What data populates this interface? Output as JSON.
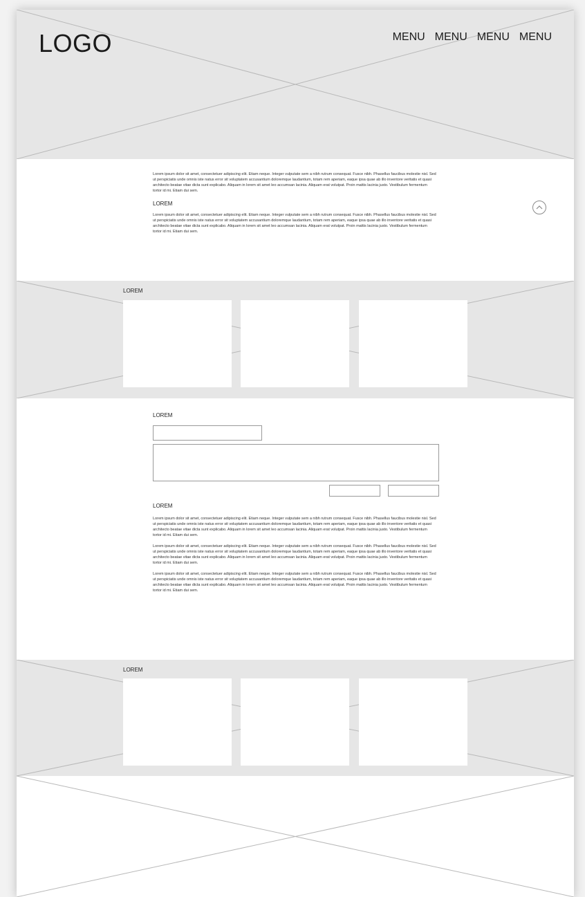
{
  "header": {
    "logo": "LOGO",
    "menu": [
      "MENU",
      "MENU",
      "MENU",
      "MENU"
    ]
  },
  "intro": {
    "paragraph_1": "Lorem ipsum dolor sit amet, consectetuer adipiscing elit. Etiam neque. Integer vulputate sem a nibh rutrum consequat. Fusce nibh. Phasellus faucibus molestie nisl. Sed ut perspiciatis unde omnis iste natus error sit voluptatem accusantium doloremque laudantium, totam rem aperiam, eaque ipsa quae ab illo inventore veritatis et quasi architecto beatae vitae dicta sunt explicabo. Aliquam in lorem sit amet leo accumsan lacinia. Aliquam erat volutpat. Proin mattis lacinia justo. Vestibulum fermentum tortor id mi. Etiam dui sem.",
    "heading": "LOREM",
    "paragraph_2": "Lorem ipsum dolor sit amet, consectetuer adipiscing elit. Etiam neque. Integer vulputate sem a nibh rutrum consequat. Fusce nibh. Phasellus faucibus molestie nisl. Sed ut perspiciatis unde omnis iste natus error sit voluptatem accusantium doloremque laudantium, totam rem aperiam, eaque ipsa quae ab illo inventore veritatis et quasi architecto beatae vitae dicta sunt explicabo. Aliquam in lorem sit amet leo accumsan lacinia. Aliquam erat volutpat. Proin mattis lacinia justo. Vestibulum fermentum tortor id mi. Etiam dui sem."
  },
  "gallery_1": {
    "label": "LOREM"
  },
  "form": {
    "heading": "LOREM",
    "text_heading": "LOREM",
    "paragraph_1": "Lorem ipsum dolor sit amet, consectetuer adipiscing elit. Etiam neque. Integer vulputate sem a nibh rutrum consequat. Fusce nibh. Phasellus faucibus molestie nisl. Sed ut perspiciatis unde omnis iste natus error sit voluptatem accusantium doloremque laudantium, totam rem aperiam, eaque ipsa quae ab illo inventore veritatis et quasi architecto beatae vitae dicta sunt explicabo. Aliquam in lorem sit amet leo accumsan lacinia. Aliquam erat volutpat. Proin mattis lacinia justo. Vestibulum fermentum tortor id mi. Etiam dui sem.",
    "paragraph_2": "Lorem ipsum dolor sit amet, consectetuer adipiscing elit. Etiam neque. Integer vulputate sem a nibh rutrum consequat. Fusce nibh. Phasellus faucibus molestie nisl. Sed ut perspiciatis unde omnis iste natus error sit voluptatem accusantium doloremque laudantium, totam rem aperiam, eaque ipsa quae ab illo inventore veritatis et quasi architecto beatae vitae dicta sunt explicabo. Aliquam in lorem sit amet leo accumsan lacinia. Aliquam erat volutpat. Proin mattis lacinia justo. Vestibulum fermentum tortor id mi. Etiam dui sem.",
    "paragraph_3": "Lorem ipsum dolor sit amet, consectetuer adipiscing elit. Etiam neque. Integer vulputate sem a nibh rutrum consequat. Fusce nibh. Phasellus faucibus molestie nisl. Sed ut perspiciatis unde omnis iste natus error sit voluptatem accusantium doloremque laudantium, totam rem aperiam, eaque ipsa quae ab illo inventore veritatis et quasi architecto beatae vitae dicta sunt explicabo. Aliquam in lorem sit amet leo accumsan lacinia. Aliquam erat volutpat. Proin mattis lacinia justo. Vestibulum fermentum tortor id mi. Etiam dui sem."
  },
  "gallery_2": {
    "label": "LOREM"
  },
  "colors": {
    "placeholder_fill": "#e6e6e6",
    "placeholder_line": "#b8b8b8",
    "page_bg": "#ffffff"
  },
  "icons": {
    "scroll_up": "chevron-up-circle-icon"
  }
}
